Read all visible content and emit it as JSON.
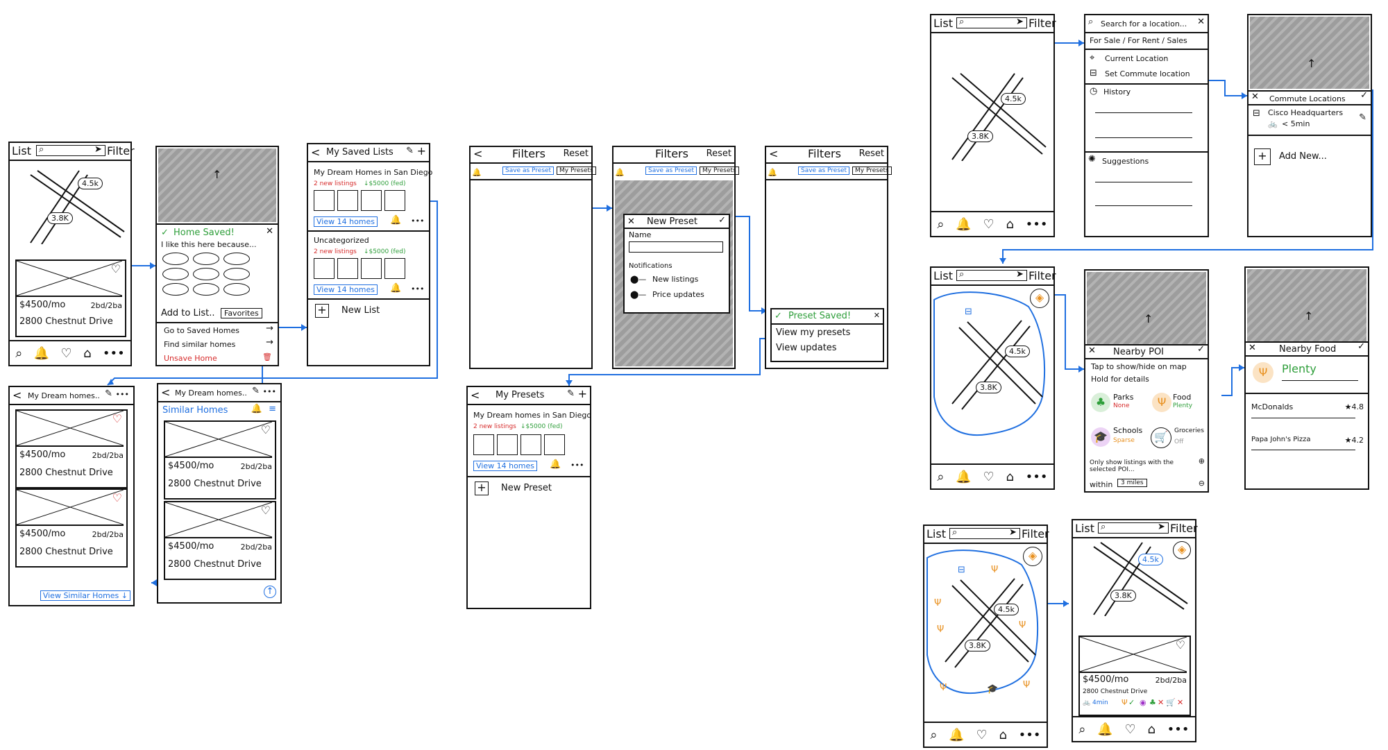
{
  "common": {
    "list": "List",
    "filter": "Filter",
    "filters": "Filters",
    "reset": "Reset",
    "save_as_preset": "Save as Preset",
    "my_presets_tab": "My Presets",
    "price": "$4500/mo",
    "beds": "2bd/2ba",
    "address": "2800 Chestnut Drive",
    "pin_a": "4.5k",
    "pin_b": "3.8K",
    "view_homes": "View 14 homes",
    "dots": "•••"
  },
  "saved": {
    "home_saved": "Home Saved!",
    "because": "I like this here because...",
    "add_to_list": "Add to List..",
    "favorites": "Favorites",
    "go_saved": "Go to Saved Homes",
    "similar": "Find similar homes",
    "unsave": "Unsave Home"
  },
  "lists": {
    "title": "My Saved Lists",
    "list1": "My Dream Homes in San Diego",
    "new_listings": "2 new listings",
    "drop": "↓$5000 (fed)",
    "uncategorized": "Uncategorized",
    "new_list": "New List"
  },
  "dream": {
    "title": "My Dream homes..",
    "view_similar": "View Similar Homes ↓"
  },
  "similar": {
    "title": "My Dream homes..",
    "header": "Similar Homes"
  },
  "preset": {
    "new_preset": "New Preset",
    "name": "Name",
    "notifications": "Notifications",
    "new_listings": "New listings",
    "price_updates": "Price updates",
    "preset_saved": "Preset Saved!",
    "view_presets": "View my presets",
    "view_updates": "View updates",
    "my_presets": "My Presets",
    "list1": "My Dream homes in San Diego",
    "new_listings_note": "2 new listings",
    "drop": "↓$5000 (fed)"
  },
  "search": {
    "placeholder": "Search for a location...",
    "tabs": "For Sale / For Rent / Sales",
    "current": "Current Location",
    "commute": "Set Commute location",
    "history": "History",
    "suggestions": "Suggestions"
  },
  "commute": {
    "title": "Commute Locations",
    "cisco": "Cisco Headquarters",
    "bike": "< 5min",
    "add_new": "Add New..."
  },
  "poi": {
    "title": "Nearby POI",
    "tap": "Tap to show/hide on map",
    "hold": "Hold for details",
    "parks": "Parks",
    "parks_val": "None",
    "food": "Food",
    "food_val": "Plenty",
    "schools": "Schools",
    "schools_val": "Sparse",
    "groceries": "Groceries",
    "groceries_val": "Off",
    "only": "Only show listings with the selected POI...",
    "within": "within",
    "miles": "3 miles"
  },
  "food": {
    "title": "Nearby Food",
    "plenty": "Plenty",
    "mcd": "McDonalds",
    "mcd_r": "★4.8",
    "papa": "Papa John's Pizza",
    "papa_r": "★4.2"
  },
  "final": {
    "bike": "4min"
  },
  "colors": {
    "blue": "#1f6fe0",
    "red": "#d62a2a",
    "green": "#2e9e3a",
    "orange": "#e8901f",
    "purple": "#a032c8"
  }
}
